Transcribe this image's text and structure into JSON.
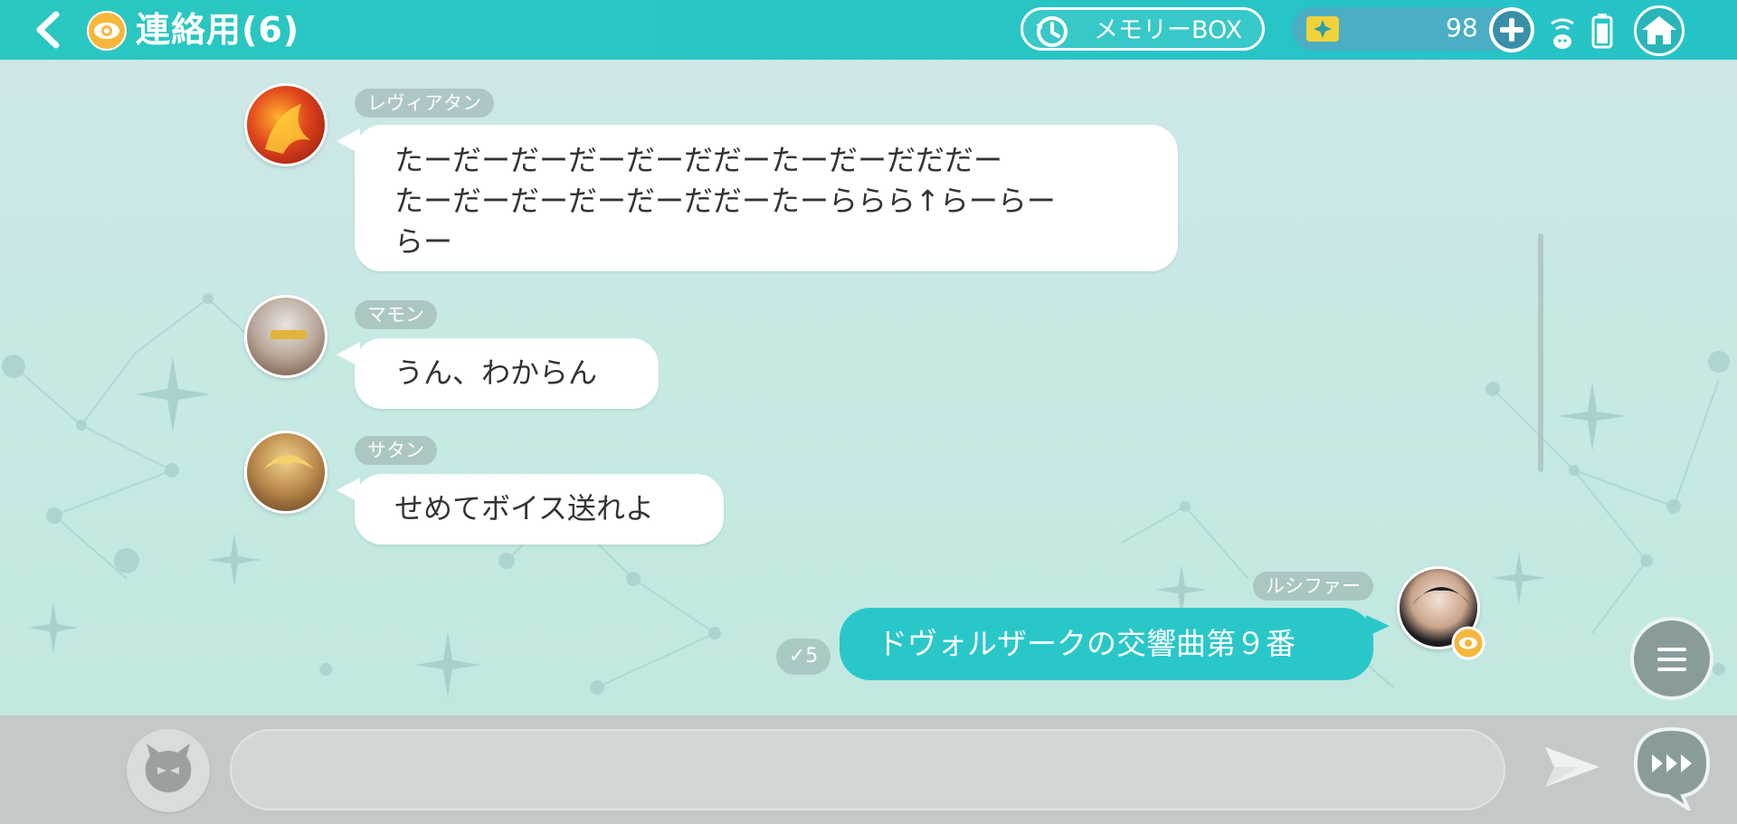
{
  "header": {
    "title": "連絡用(6)",
    "memory_box_label": "メモリーBOX",
    "gem_count": "98"
  },
  "messages": [
    {
      "sender": "レヴィアタン",
      "lines": [
        "たーだーだーだーだーだだーたーだーだだだー",
        "たーだーだーだーだーだだーたーららら↑らーらー",
        "らー"
      ]
    },
    {
      "sender": "マモン",
      "lines": [
        "うん、わからん"
      ]
    },
    {
      "sender": "サタン",
      "lines": [
        "せめてボイス送れよ"
      ]
    },
    {
      "sender": "ルシファー",
      "lines": [
        "ドヴォルザークの交響曲第９番"
      ],
      "mine": true,
      "read_count": "✓5"
    }
  ],
  "input": {
    "placeholder": ""
  },
  "colors": {
    "header": "#2bc7c2",
    "my_bubble": "#2ac7c9",
    "accent_badge": "#f6b73c"
  },
  "icons": {
    "back": "chevron-left-icon",
    "eye": "eye-icon",
    "memory": "history-clock-icon",
    "gem": "gem-icon",
    "plus": "plus-icon",
    "wifi": "wifi-icon",
    "battery": "battery-icon",
    "home": "home-icon",
    "menu": "hamburger-icon",
    "stamp": "devil-face-icon",
    "send": "send-icon",
    "skip": "fast-forward-icon"
  }
}
